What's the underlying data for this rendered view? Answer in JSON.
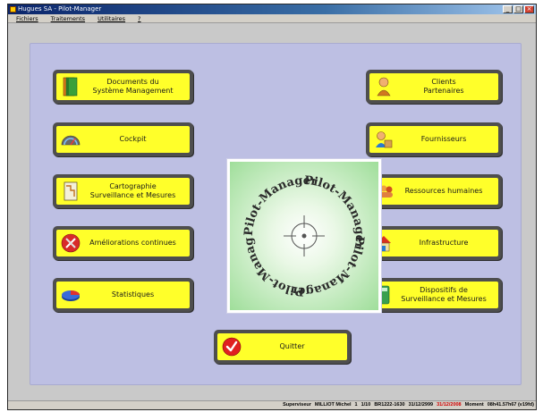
{
  "window": {
    "title": "Hugues SA - Pilot-Manager"
  },
  "menu": [
    {
      "label": "Fichiers"
    },
    {
      "label": "Traitements"
    },
    {
      "label": "Utilitaires"
    },
    {
      "label": "?"
    }
  ],
  "buttons_left": [
    {
      "label": "Documents du\nSystème Management",
      "icon": "book-icon"
    },
    {
      "label": "Cockpit",
      "icon": "gauge-icon"
    },
    {
      "label": "Cartographie\nSurveillance et Mesures",
      "icon": "map-icon"
    },
    {
      "label": "Améliorations continues",
      "icon": "tools-icon"
    },
    {
      "label": "Statistiques",
      "icon": "pie-chart-icon"
    }
  ],
  "buttons_right": [
    {
      "label": "Clients\nPartenaires",
      "icon": "client-icon"
    },
    {
      "label": "Fournisseurs",
      "icon": "supplier-icon"
    },
    {
      "label": "Ressources humaines",
      "icon": "people-icon"
    },
    {
      "label": "Infrastructure",
      "icon": "house-icon"
    },
    {
      "label": "Dispositifs de\nSurveillance et Mesures",
      "icon": "instrument-icon"
    }
  ],
  "quit_button": {
    "label": "Quitter",
    "icon": "check-icon"
  },
  "logo": {
    "text": "Pilot-Manager"
  },
  "status": {
    "role": "Superviseur",
    "user": "MILLIOT Michel",
    "counter": "1",
    "page": "1/10",
    "id": "BR1222-1630",
    "date1": "31/12/2999",
    "date2": "31/12/2008",
    "moment_label": "Moment",
    "moment_value": "08h41.57h67 (v19fd)"
  },
  "colors": {
    "button_fill": "#ffff2a",
    "button_frame": "#4e4e4e",
    "panel": "#bdbfe3",
    "logo_green": "#9fde9a",
    "status_red": "#d00000"
  }
}
